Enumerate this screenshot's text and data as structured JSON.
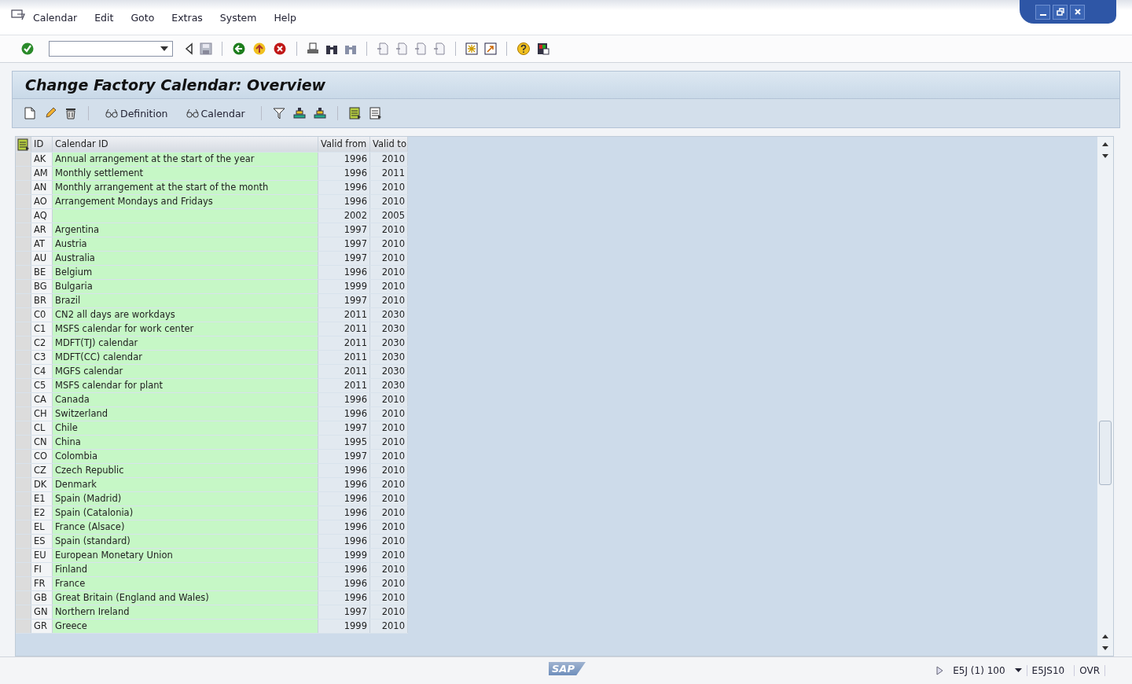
{
  "menu": [
    "Calendar",
    "Edit",
    "Goto",
    "Extras",
    "System",
    "Help"
  ],
  "title": "Change Factory Calendar: Overview",
  "app_toolbar": {
    "buttons": [
      {
        "kind": "create"
      },
      {
        "kind": "edit"
      },
      {
        "kind": "delete"
      },
      {
        "kind": "sep"
      },
      {
        "kind": "text",
        "label": "Definition"
      },
      {
        "kind": "text",
        "label": "Calendar"
      },
      {
        "kind": "sep"
      },
      {
        "kind": "filter"
      },
      {
        "kind": "sort"
      },
      {
        "kind": "sort"
      },
      {
        "kind": "sep"
      },
      {
        "kind": "layout"
      },
      {
        "kind": "layout2"
      }
    ]
  },
  "table": {
    "columns": [
      "ID",
      "Calendar ID",
      "Valid from",
      "Valid to"
    ],
    "rows": [
      [
        "AK",
        "Annual arrangement at the start of the year",
        "1996",
        "2010"
      ],
      [
        "AM",
        "Monthly settlement",
        "1996",
        "2011"
      ],
      [
        "AN",
        "Monthly arrangement at the start of the month",
        "1996",
        "2010"
      ],
      [
        "AO",
        "Arrangement Mondays and Fridays",
        "1996",
        "2010"
      ],
      [
        "AQ",
        "",
        "2002",
        "2005"
      ],
      [
        "AR",
        "Argentina",
        "1997",
        "2010"
      ],
      [
        "AT",
        "Austria",
        "1997",
        "2010"
      ],
      [
        "AU",
        "Australia",
        "1997",
        "2010"
      ],
      [
        "BE",
        "Belgium",
        "1996",
        "2010"
      ],
      [
        "BG",
        "Bulgaria",
        "1999",
        "2010"
      ],
      [
        "BR",
        "Brazil",
        "1997",
        "2010"
      ],
      [
        "C0",
        "CN2 all days are workdays",
        "2011",
        "2030"
      ],
      [
        "C1",
        "MSFS calendar for work center",
        "2011",
        "2030"
      ],
      [
        "C2",
        "MDFT(TJ) calendar",
        "2011",
        "2030"
      ],
      [
        "C3",
        "MDFT(CC) calendar",
        "2011",
        "2030"
      ],
      [
        "C4",
        "MGFS calendar",
        "2011",
        "2030"
      ],
      [
        "C5",
        "MSFS calendar for plant",
        "2011",
        "2030"
      ],
      [
        "CA",
        "Canada",
        "1996",
        "2010"
      ],
      [
        "CH",
        "Switzerland",
        "1996",
        "2010"
      ],
      [
        "CL",
        "Chile",
        "1997",
        "2010"
      ],
      [
        "CN",
        "China",
        "1995",
        "2010"
      ],
      [
        "CO",
        "Colombia",
        "1997",
        "2010"
      ],
      [
        "CZ",
        "Czech Republic",
        "1996",
        "2010"
      ],
      [
        "DK",
        "Denmark",
        "1996",
        "2010"
      ],
      [
        "E1",
        "Spain (Madrid)",
        "1996",
        "2010"
      ],
      [
        "E2",
        "Spain (Catalonia)",
        "1996",
        "2010"
      ],
      [
        "EL",
        "France (Alsace)",
        "1996",
        "2010"
      ],
      [
        "ES",
        "Spain (standard)",
        "1996",
        "2010"
      ],
      [
        "EU",
        "European Monetary Union",
        "1999",
        "2010"
      ],
      [
        "FI",
        "Finland",
        "1996",
        "2010"
      ],
      [
        "FR",
        "France",
        "1996",
        "2010"
      ],
      [
        "GB",
        "Great Britain (England and Wales)",
        "1996",
        "2010"
      ],
      [
        "GN",
        "Northern Ireland",
        "1997",
        "2010"
      ],
      [
        "GR",
        "Greece",
        "1999",
        "2010"
      ]
    ]
  },
  "status_bar": {
    "logo": "SAP",
    "system": "E5J (1) 100",
    "server": "E5JS10",
    "mode": "OVR"
  }
}
